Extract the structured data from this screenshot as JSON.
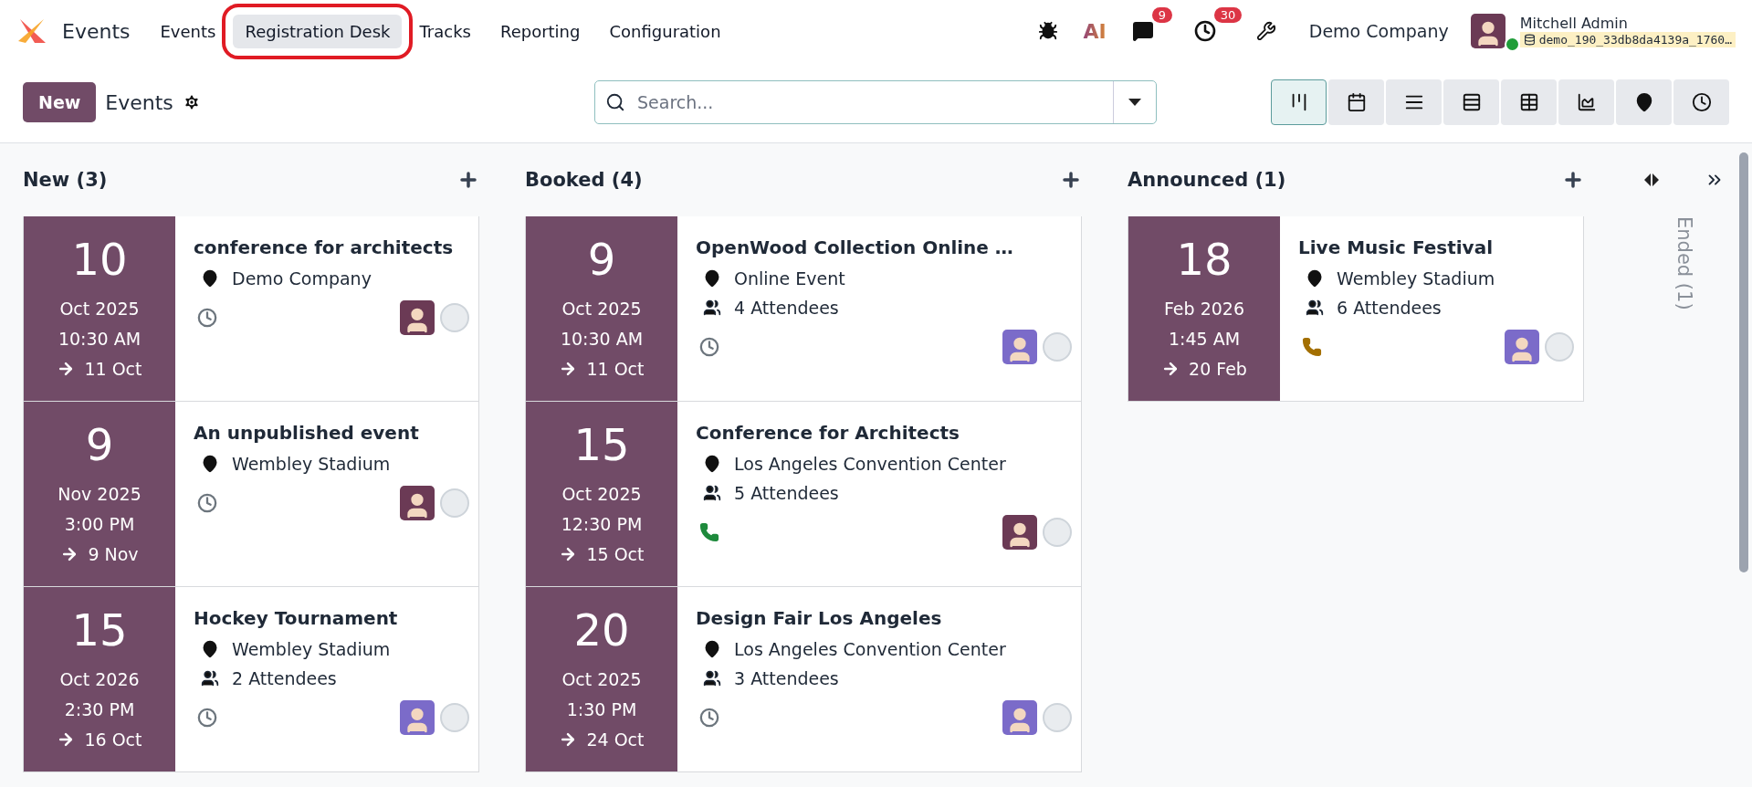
{
  "navbar": {
    "app_name": "Events",
    "menu": [
      {
        "label": "Events",
        "selected": false,
        "annotated": false
      },
      {
        "label": "Registration Desk",
        "selected": true,
        "annotated": true
      },
      {
        "label": "Tracks",
        "selected": false,
        "annotated": false
      },
      {
        "label": "Reporting",
        "selected": false,
        "annotated": false
      },
      {
        "label": "Configuration",
        "selected": false,
        "annotated": false
      }
    ],
    "ai_label": "AI",
    "messages_badge": "9",
    "activities_badge": "30",
    "company": "Demo Company",
    "user": {
      "name": "Mitchell Admin",
      "database": "demo_190_33db8da4139a_1760…"
    }
  },
  "control_panel": {
    "new_button": "New",
    "title": "Events",
    "search": {
      "placeholder": "Search..."
    },
    "views": [
      {
        "kind": "kanban",
        "selected": true
      },
      {
        "kind": "calendar",
        "selected": false
      },
      {
        "kind": "list",
        "selected": false
      },
      {
        "kind": "gantt",
        "selected": false
      },
      {
        "kind": "pivot",
        "selected": false
      },
      {
        "kind": "graph",
        "selected": false
      },
      {
        "kind": "map",
        "selected": false
      },
      {
        "kind": "activity",
        "selected": false
      }
    ]
  },
  "columns": [
    {
      "title": "New (3)",
      "wide": false,
      "cards": [
        {
          "day": "10",
          "month_year": "Oct 2025",
          "time": "10:30 AM",
          "end": "11 Oct",
          "name": "conference for architects",
          "location": "Demo Company",
          "activity": {
            "kind": "clock",
            "color": "#6c757d"
          },
          "avatar": {
            "kind": "admin"
          }
        },
        {
          "day": "9",
          "month_year": "Nov 2025",
          "time": "3:00 PM",
          "end": "9 Nov",
          "name": "An unpublished event",
          "location": "Wembley Stadium",
          "activity": {
            "kind": "clock",
            "color": "#6c757d"
          },
          "avatar": {
            "kind": "admin"
          }
        },
        {
          "day": "15",
          "month_year": "Oct 2026",
          "time": "2:30 PM",
          "end": "16 Oct",
          "name": "Hockey Tournament",
          "location": "Wembley Stadium",
          "attendees": "2 Attendees",
          "activity": {
            "kind": "clock",
            "color": "#6c757d"
          },
          "avatar": {
            "kind": "user"
          }
        }
      ]
    },
    {
      "title": "Booked (4)",
      "wide": true,
      "cards": [
        {
          "day": "9",
          "month_year": "Oct 2025",
          "time": "10:30 AM",
          "end": "11 Oct",
          "name": "OpenWood Collection Online …",
          "location": "Online Event",
          "attendees": "4 Attendees",
          "activity": {
            "kind": "clock",
            "color": "#6c757d"
          },
          "avatar": {
            "kind": "user"
          }
        },
        {
          "day": "15",
          "month_year": "Oct 2025",
          "time": "12:30 PM",
          "end": "15 Oct",
          "name": "Conference for Architects",
          "location": "Los Angeles Convention Center",
          "attendees": "5 Attendees",
          "activity": {
            "kind": "phone",
            "color": "#1e8a3c"
          },
          "avatar": {
            "kind": "admin"
          }
        },
        {
          "day": "20",
          "month_year": "Oct 2025",
          "time": "1:30 PM",
          "end": "24 Oct",
          "name": "Design Fair Los Angeles",
          "location": "Los Angeles Convention Center",
          "attendees": "3 Attendees",
          "activity": {
            "kind": "clock",
            "color": "#6c757d"
          },
          "avatar": {
            "kind": "user"
          }
        }
      ]
    },
    {
      "title": "Announced (1)",
      "wide": false,
      "cards": [
        {
          "day": "18",
          "month_year": "Feb 2026",
          "time": "1:45 AM",
          "end": "20 Feb",
          "name": "Live Music Festival",
          "location": "Wembley Stadium",
          "attendees": "6 Attendees",
          "activity": {
            "kind": "phone",
            "color": "#a36f00"
          },
          "avatar": {
            "kind": "user"
          }
        }
      ]
    }
  ],
  "folded_columns": [
    {
      "title": "Ended (1)"
    }
  ]
}
